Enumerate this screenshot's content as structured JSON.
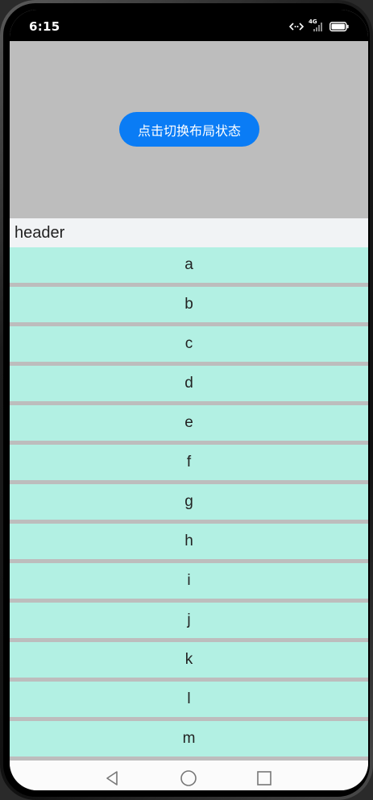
{
  "status_bar": {
    "time": "6:15",
    "network_label": "4G"
  },
  "main": {
    "toggle_button_label": "点击切换布局状态"
  },
  "list": {
    "header": "header",
    "items": [
      "a",
      "b",
      "c",
      "d",
      "e",
      "f",
      "g",
      "h",
      "i",
      "j",
      "k",
      "l",
      "m"
    ]
  },
  "nav_bar": {
    "icons": [
      "back-icon",
      "home-icon",
      "recents-icon"
    ]
  },
  "colors": {
    "button": "#0a7cf5",
    "item_background": "#b2f0e3",
    "separator": "#bdbdbd",
    "header_background": "#f1f3f5"
  }
}
